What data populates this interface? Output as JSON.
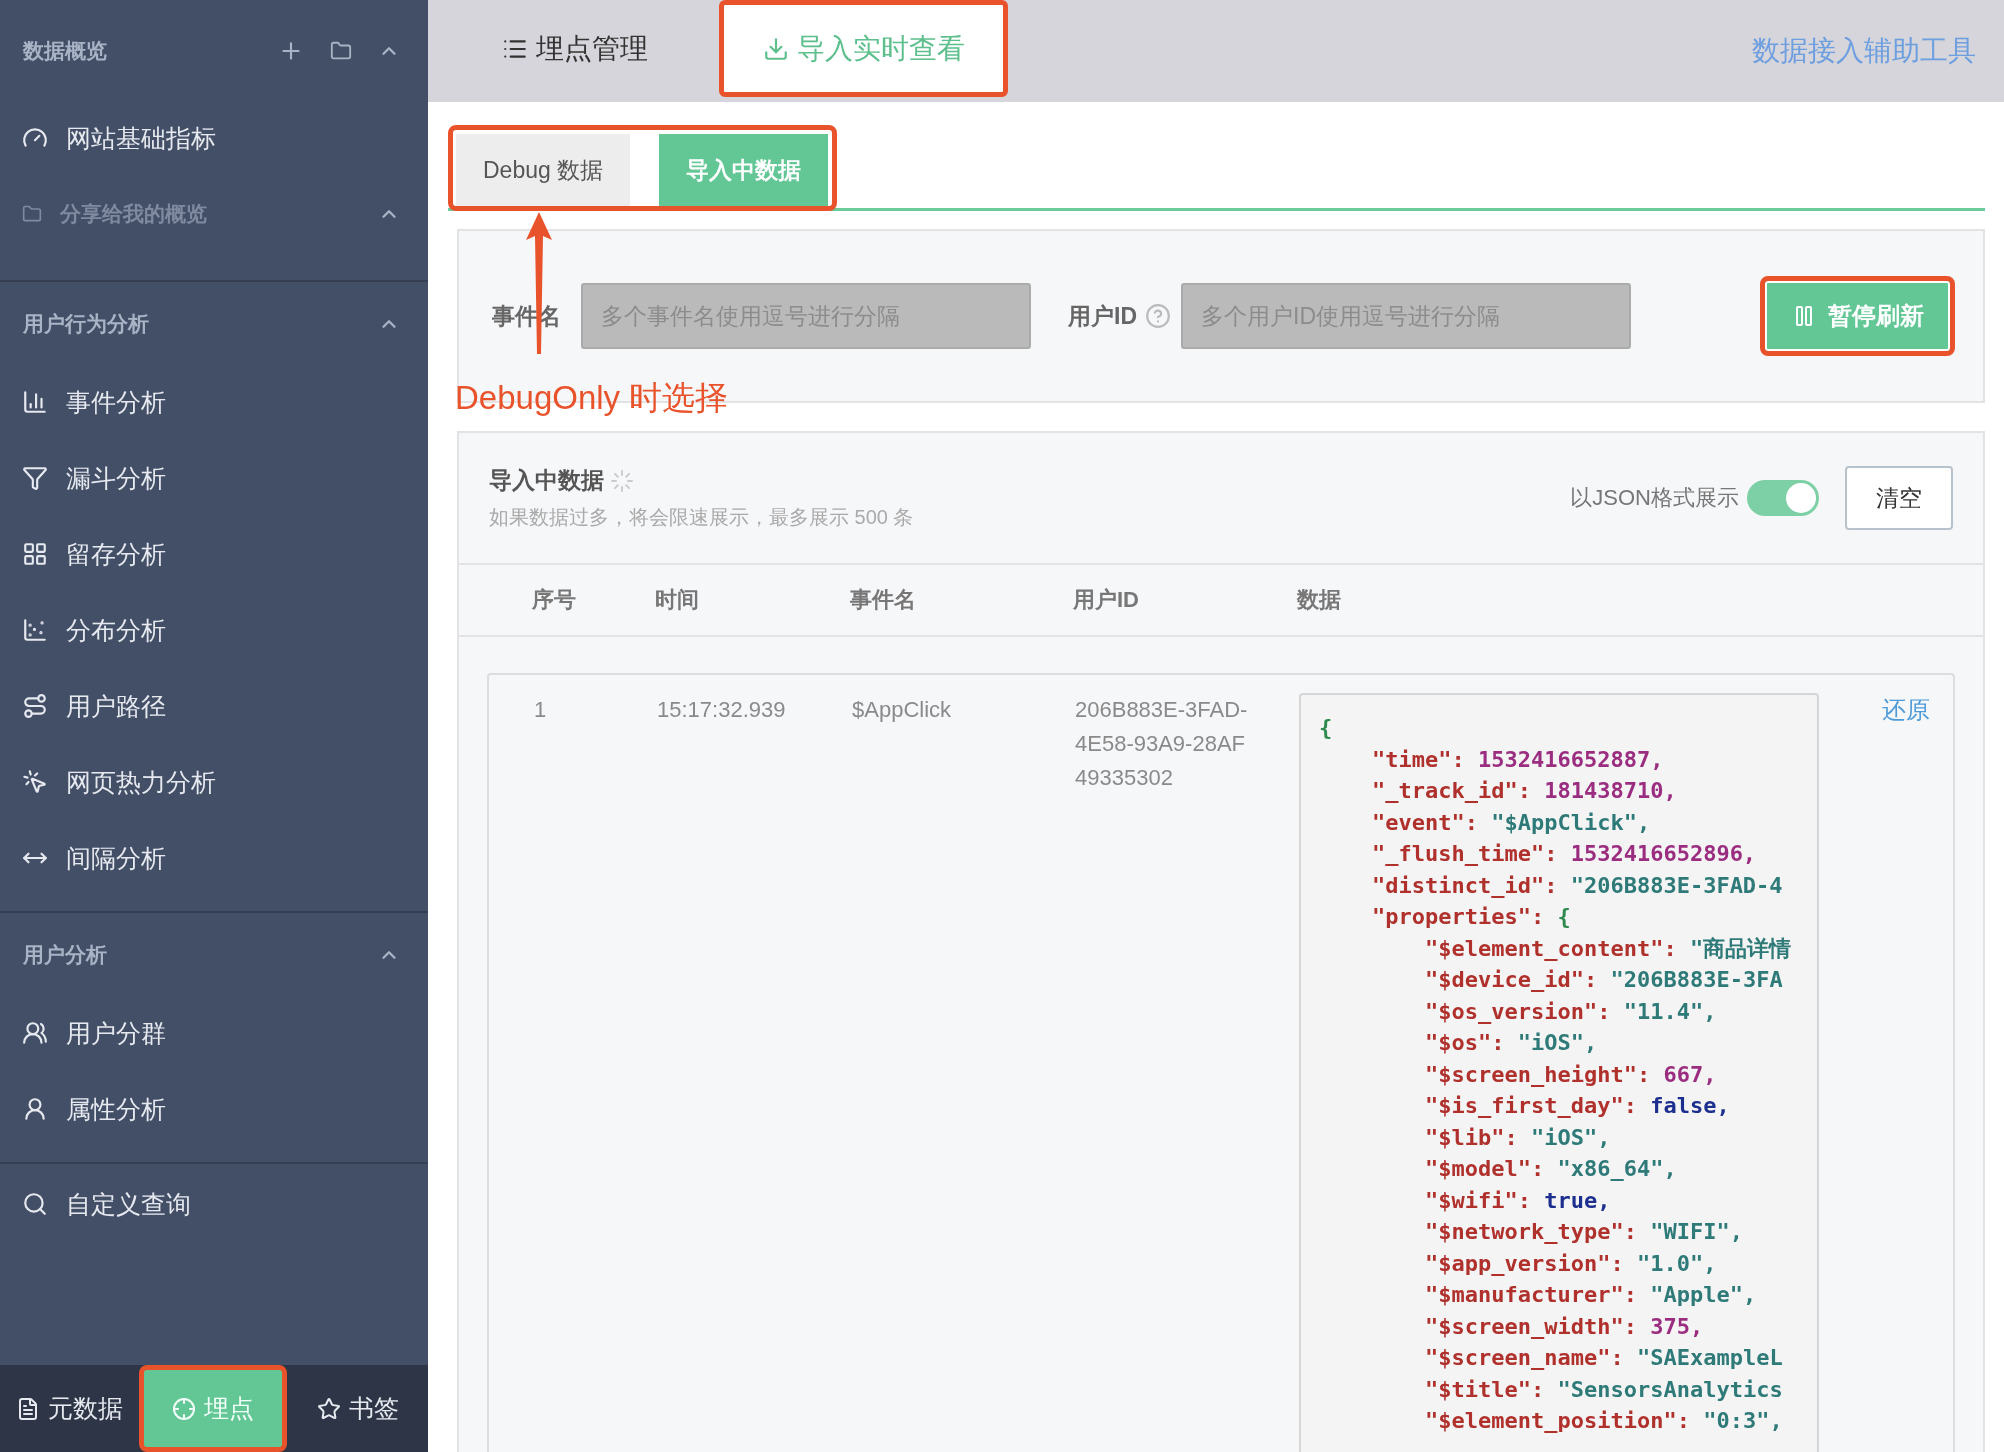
{
  "sidebar": {
    "sections": [
      {
        "kind": "overview",
        "title": "数据概览",
        "expanded": true,
        "items": [
          {
            "label": "网站基础指标"
          }
        ],
        "shared": {
          "title": "分享给我的概览",
          "expanded": true
        }
      },
      {
        "kind": "group",
        "title": "用户行为分析",
        "expanded": true,
        "items": [
          {
            "label": "事件分析"
          },
          {
            "label": "漏斗分析"
          },
          {
            "label": "留存分析"
          },
          {
            "label": "分布分析"
          },
          {
            "label": "用户路径"
          },
          {
            "label": "网页热力分析"
          },
          {
            "label": "间隔分析"
          }
        ]
      },
      {
        "kind": "group",
        "title": "用户分析",
        "expanded": true,
        "items": [
          {
            "label": "用户分群"
          },
          {
            "label": "属性分析"
          }
        ]
      },
      {
        "kind": "plain",
        "items": [
          {
            "label": "自定义查询"
          }
        ]
      }
    ],
    "bottom_tabs": [
      {
        "label": "元数据",
        "selected": false,
        "highlighted": false
      },
      {
        "label": "埋点",
        "selected": true,
        "highlighted": true
      },
      {
        "label": "书签",
        "selected": false,
        "highlighted": false
      }
    ]
  },
  "top_tabs": [
    {
      "label": "埋点管理",
      "selected": false,
      "highlighted": false
    },
    {
      "label": "导入实时查看",
      "selected": true,
      "highlighted": true
    }
  ],
  "helper_link": "数据接入辅助工具",
  "sub_tabs": {
    "highlighted": true,
    "tabs": [
      {
        "label": "Debug 数据",
        "selected": false
      },
      {
        "label": "导入中数据",
        "selected": true
      }
    ]
  },
  "filters": {
    "event": {
      "label": "事件名",
      "placeholder": "多个事件名使用逗号进行分隔",
      "disabled": true
    },
    "user": {
      "label": "用户ID",
      "placeholder": "多个用户ID使用逗号进行分隔",
      "disabled": true
    },
    "pause_button": {
      "label": "暂停刷新",
      "highlighted": true
    }
  },
  "annotation": {
    "text": "DebugOnly 时选择"
  },
  "data_panel": {
    "title": "导入中数据",
    "loading": true,
    "subtitle": "如果数据过多，将会限速展示，最多展示 500 条",
    "json_toggle": {
      "label": "以JSON格式展示",
      "on": true
    },
    "clear_button": "清空",
    "table": {
      "columns": [
        "序号",
        "时间",
        "事件名",
        "用户ID",
        "数据"
      ],
      "rows": [
        {
          "index": "1",
          "time": "15:17:32.939",
          "event": "$AppClick",
          "user_id": "206B883E-3FAD-4E58-93A9-28AF49335302",
          "action": "还原",
          "json": {
            "open": "{",
            "entries": [
              {
                "key": "\"time\":",
                "value": "1532416652887,",
                "kind": "number"
              },
              {
                "key": "\"_track_id\":",
                "value": "181438710,",
                "kind": "number"
              },
              {
                "key": "\"event\":",
                "value": "\"$AppClick\",",
                "kind": "string"
              },
              {
                "key": "\"_flush_time\":",
                "value": "1532416652896,",
                "kind": "number"
              },
              {
                "key": "\"distinct_id\":",
                "value": "\"206B883E-3FAD-4",
                "kind": "string"
              },
              {
                "key": "\"properties\":",
                "value": "{",
                "kind": "brace",
                "children": [
                  {
                    "key": "\"$element_content\":",
                    "value": "\"商品详情",
                    "kind": "string"
                  },
                  {
                    "key": "\"$device_id\":",
                    "value": "\"206B883E-3FA",
                    "kind": "string"
                  },
                  {
                    "key": "\"$os_version\":",
                    "value": "\"11.4\",",
                    "kind": "string"
                  },
                  {
                    "key": "\"$os\":",
                    "value": "\"iOS\",",
                    "kind": "string"
                  },
                  {
                    "key": "\"$screen_height\":",
                    "value": "667,",
                    "kind": "number"
                  },
                  {
                    "key": "\"$is_first_day\":",
                    "value": "false,",
                    "kind": "boolean"
                  },
                  {
                    "key": "\"$lib\":",
                    "value": "\"iOS\",",
                    "kind": "string"
                  },
                  {
                    "key": "\"$model\":",
                    "value": "\"x86_64\",",
                    "kind": "string"
                  },
                  {
                    "key": "\"$wifi\":",
                    "value": "true,",
                    "kind": "boolean"
                  },
                  {
                    "key": "\"$network_type\":",
                    "value": "\"WIFI\",",
                    "kind": "string"
                  },
                  {
                    "key": "\"$app_version\":",
                    "value": "\"1.0\",",
                    "kind": "string"
                  },
                  {
                    "key": "\"$manufacturer\":",
                    "value": "\"Apple\",",
                    "kind": "string"
                  },
                  {
                    "key": "\"$screen_width\":",
                    "value": "375,",
                    "kind": "number"
                  },
                  {
                    "key": "\"$screen_name\":",
                    "value": "\"SAExampleL",
                    "kind": "string"
                  },
                  {
                    "key": "\"$title\":",
                    "value": "\"SensorsAnalytics",
                    "kind": "string"
                  },
                  {
                    "key": "\"$element_position\":",
                    "value": "\"0:3\",",
                    "kind": "string"
                  }
                ]
              }
            ]
          }
        }
      ]
    }
  }
}
